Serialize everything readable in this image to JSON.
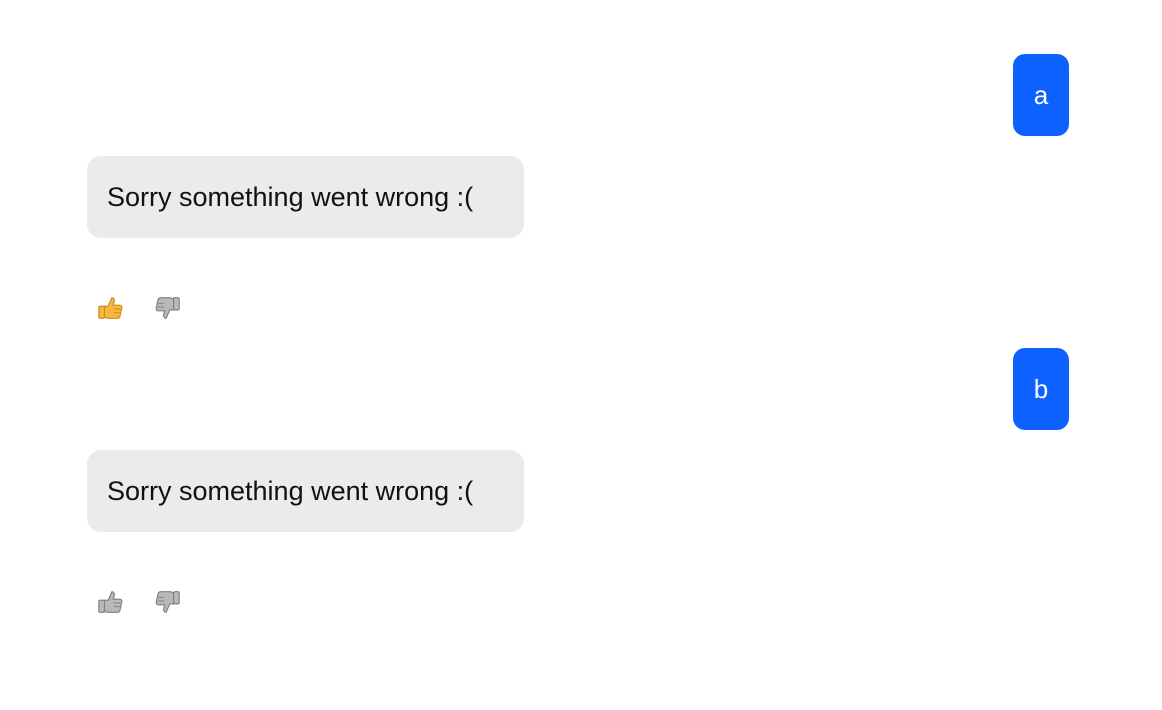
{
  "messages": [
    {
      "role": "user",
      "text": "a"
    },
    {
      "role": "assistant",
      "text": "Sorry something went wrong :(",
      "feedback": {
        "up_state": "selected",
        "down_state": "unselected"
      }
    },
    {
      "role": "user",
      "text": "b"
    },
    {
      "role": "assistant",
      "text": "Sorry something went wrong :(",
      "feedback": {
        "up_state": "unselected",
        "down_state": "unselected"
      }
    }
  ],
  "colors": {
    "user_bubble": "#0d61fe",
    "bot_bubble": "#ebebeb",
    "thumb_selected": "#f6b73c",
    "thumb_unselected": "#b9b9b9"
  },
  "icons": {
    "thumbs_up": "thumbs-up-icon",
    "thumbs_down": "thumbs-down-icon"
  }
}
